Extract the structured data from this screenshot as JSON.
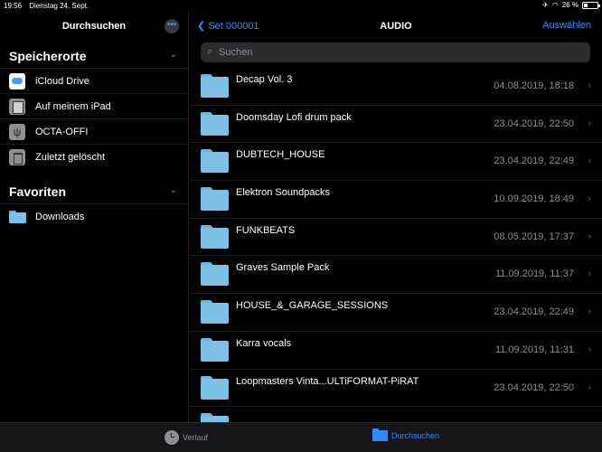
{
  "status": {
    "time": "19:56",
    "date": "Dienstag 24. Sept.",
    "battery": "26 %",
    "battery_level": 0.26
  },
  "sidebar": {
    "title": "Durchsuchen",
    "more_icon": "ellipsis-icon",
    "sections": [
      {
        "label": "Speicherorte",
        "items": [
          {
            "label": "iCloud Drive",
            "icon": "icloud-icon"
          },
          {
            "label": "Auf meinem iPad",
            "icon": "ipad-icon"
          },
          {
            "label": "OCTA-OFFI",
            "icon": "usb-icon"
          },
          {
            "label": "Zuletzt gelöscht",
            "icon": "trash-icon"
          }
        ]
      },
      {
        "label": "Favoriten",
        "items": [
          {
            "label": "Downloads",
            "icon": "folder-icon"
          }
        ]
      }
    ]
  },
  "main": {
    "back_label": "Set 000001",
    "title": "AUDIO",
    "select_label": "Auswählen",
    "search_placeholder": "Suchen",
    "files": [
      {
        "name": "Decap Vol. 3",
        "date": "04.08.2019, 18:18"
      },
      {
        "name": "Doomsday Lofi drum pack",
        "date": "23.04.2019, 22:50"
      },
      {
        "name": "DUBTECH_HOUSE",
        "date": "23.04.2019, 22:49"
      },
      {
        "name": "Elektron Soundpacks",
        "date": "10.09.2019, 18:49"
      },
      {
        "name": "FUNKBEATS",
        "date": "08.05.2019, 17:37"
      },
      {
        "name": "Graves Sample Pack",
        "date": "11.09.2019, 11:37"
      },
      {
        "name": "HOUSE_&_GARAGE_SESSIONS",
        "date": "23.04.2019, 22:49"
      },
      {
        "name": "Karra vocals",
        "date": "11.09.2019, 11:31"
      },
      {
        "name": "Loopmasters Vinta...ULTiFORMAT-PiRAT",
        "date": "23.04.2019, 22:50"
      },
      {
        "name": "",
        "date": ""
      }
    ]
  },
  "tabbar": {
    "recent_label": "Verlauf",
    "browse_label": "Durchsuchen"
  },
  "colors": {
    "accent": "#2f8bff",
    "folder": "#7cc0e6",
    "background": "#000000"
  }
}
